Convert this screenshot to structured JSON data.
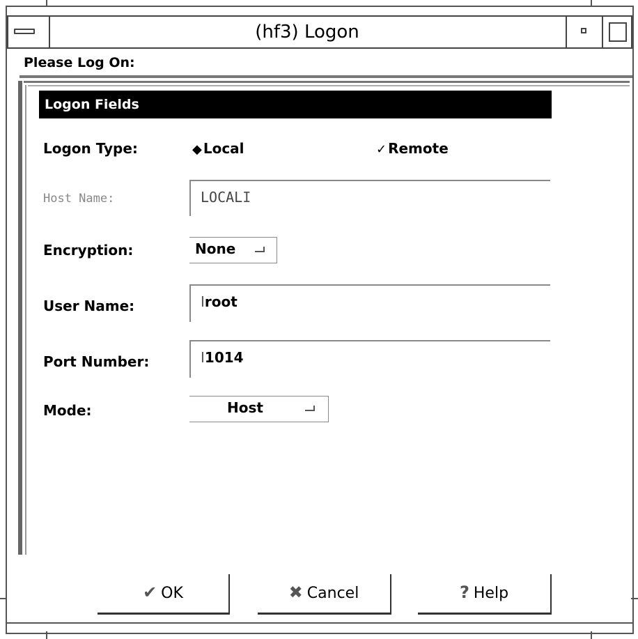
{
  "window": {
    "title": "(hf3) Logon",
    "header": "Please Log On:"
  },
  "section": {
    "title": "Logon Fields"
  },
  "logon_type": {
    "label": "Logon Type:",
    "options": [
      {
        "label": "Local",
        "selected": true,
        "icon": "diamond-radio-icon"
      },
      {
        "label": "Remote",
        "selected": false,
        "icon": "check-radio-icon"
      }
    ]
  },
  "host_name": {
    "label": "Host Name:",
    "value": "LOCAL",
    "enabled": false
  },
  "encryption": {
    "label": "Encryption:",
    "value": "None"
  },
  "user_name": {
    "label": "User Name:",
    "value": "root"
  },
  "port_number": {
    "label": "Port Number:",
    "value": "1014"
  },
  "mode": {
    "label": "Mode:",
    "value": "Host"
  },
  "buttons": {
    "ok": "OK",
    "cancel": "Cancel",
    "help": "Help"
  },
  "icons": {
    "ok": "checkmark-icon",
    "cancel": "x-icon",
    "help": "question-mark-icon"
  },
  "colors": {
    "section_bar_bg": "#000000",
    "section_bar_text": "#ffffff",
    "disabled_text": "#888888"
  }
}
